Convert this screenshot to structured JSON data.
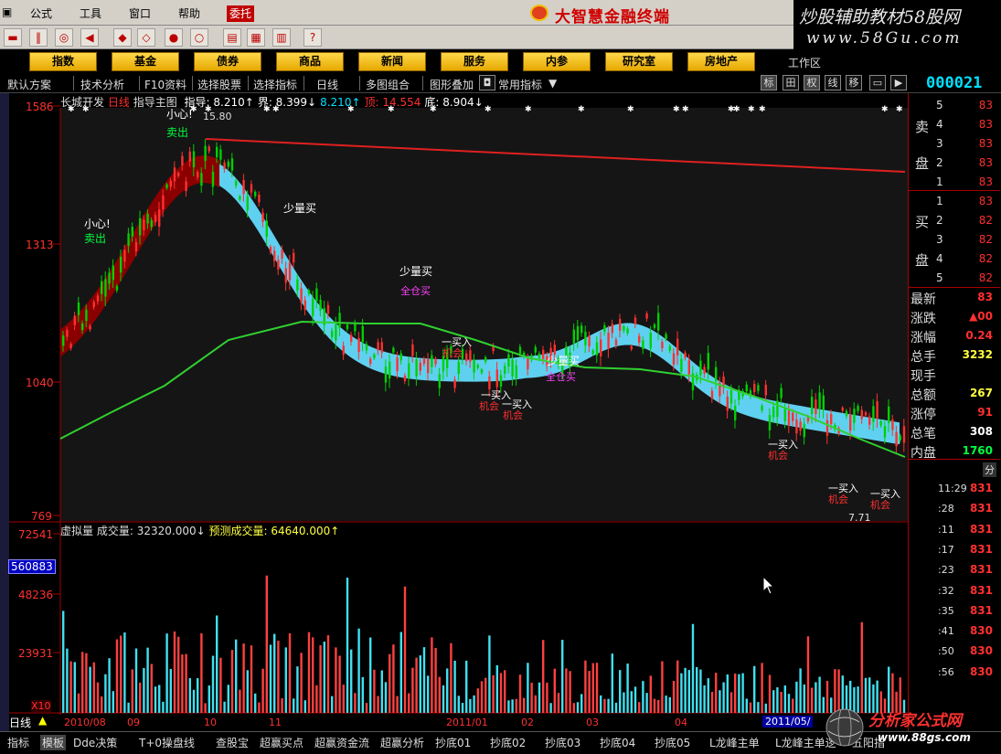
{
  "menu": {
    "items": [
      "公式",
      "工具",
      "窗口",
      "帮助"
    ],
    "red_item": "委托",
    "brand": "大智慧金融终端"
  },
  "watermark_top": {
    "line1": "炒股辅助教材58股网",
    "line2": "www.58Gu.com"
  },
  "nav_buttons": [
    "指数",
    "基金",
    "债券",
    "商品",
    "新闻",
    "服务",
    "内参",
    "研究室",
    "房地产"
  ],
  "workarea_label": "工作区",
  "tabs": [
    "默认方案",
    "技术分析",
    "F10资料",
    "选择股票",
    "选择指标",
    "日线",
    "多图组合",
    "图形叠加",
    "常用指标"
  ],
  "right_tabs": [
    "标",
    "田",
    "权",
    "线",
    "移"
  ],
  "stock_code": "000021",
  "price_chart": {
    "indicator_line": "长城开发",
    "period": "日线",
    "legend_prefix": "指导主图",
    "legend_items": [
      {
        "label": "指导",
        "value": "8.210↑",
        "color": "#ffffff"
      },
      {
        "label": "界",
        "value": "8.399↓",
        "color": "#ffffff"
      },
      {
        "label": "",
        "value": "8.210↑",
        "color": "#00e0ff"
      },
      {
        "label": "顶",
        "value": "14.554",
        "color": "#ff3030"
      },
      {
        "label": "底",
        "value": "8.904↓",
        "color": "#ffffff"
      }
    ],
    "y_ticks": [
      "1586",
      "1313",
      "1040",
      "769"
    ],
    "high_label": "15.80",
    "low_label": "7.71",
    "annotations": [
      {
        "text": "小心!",
        "color": "#ffffff"
      },
      {
        "text": "卖出",
        "color": "#00ff40"
      },
      {
        "text": "小心!",
        "color": "#ffffff"
      },
      {
        "text": "卖出",
        "color": "#00ff40"
      },
      {
        "text": "少量买",
        "color": "#ffffff"
      },
      {
        "text": "少量买",
        "color": "#ffffff"
      },
      {
        "text": "全仓买",
        "color": "#ff40ff"
      },
      {
        "text": "一买入",
        "color": "#ffffff"
      },
      {
        "text": "机会",
        "color": "#ff3030"
      },
      {
        "text": "一买入",
        "color": "#ffffff"
      },
      {
        "text": "机会",
        "color": "#ff3030"
      },
      {
        "text": "一买入",
        "color": "#ffffff"
      },
      {
        "text": "机会",
        "color": "#ff3030"
      },
      {
        "text": "少量买",
        "color": "#ffffff"
      },
      {
        "text": "全仓买",
        "color": "#ff40ff"
      },
      {
        "text": "一买入",
        "color": "#ffffff"
      },
      {
        "text": "机会",
        "color": "#ff3030"
      },
      {
        "text": "一买入",
        "color": "#ffffff"
      },
      {
        "text": "机会",
        "color": "#ff3030"
      },
      {
        "text": "一买入",
        "color": "#ffffff"
      },
      {
        "text": "机会",
        "color": "#ff3030"
      }
    ]
  },
  "volume_chart": {
    "legend_prefix": "虚拟量",
    "vol_label": "成交量:",
    "vol_value": "32320.000↓",
    "pred_label": "预测成交量:",
    "pred_value": "64640.000↑",
    "y_ticks": [
      "72541",
      "48236",
      "23931"
    ],
    "highlight_tick": "560883",
    "unit": "X10"
  },
  "x_axis": {
    "period_label": "日线",
    "labels": [
      "2010/08",
      "09",
      "10",
      "11",
      "2011/01",
      "02",
      "03",
      "04",
      "2011/05/"
    ]
  },
  "right_panel": {
    "sell_label": [
      "卖",
      "盘"
    ],
    "buy_label": [
      "买",
      "盘"
    ],
    "sell_rows": [
      {
        "n": "5",
        "p": "83"
      },
      {
        "n": "4",
        "p": "83"
      },
      {
        "n": "3",
        "p": "83"
      },
      {
        "n": "2",
        "p": "83"
      },
      {
        "n": "1",
        "p": "83"
      }
    ],
    "buy_rows": [
      {
        "n": "1",
        "p": "83"
      },
      {
        "n": "2",
        "p": "82"
      },
      {
        "n": "3",
        "p": "82"
      },
      {
        "n": "4",
        "p": "82"
      },
      {
        "n": "5",
        "p": "82"
      }
    ],
    "stats": [
      {
        "k": "最新",
        "v": "83",
        "color": "#ff3030"
      },
      {
        "k": "涨跌",
        "v": "▲00",
        "color": "#ff3030"
      },
      {
        "k": "涨幅",
        "v": "0.24",
        "color": "#ff3030"
      },
      {
        "k": "总手",
        "v": "3232",
        "color": "#ffff40"
      },
      {
        "k": "现手",
        "v": "",
        "color": "#ffff40"
      },
      {
        "k": "总额",
        "v": "267",
        "color": "#ffff40"
      },
      {
        "k": "涨停",
        "v": "91",
        "color": "#ff3030"
      },
      {
        "k": "总笔",
        "v": "308",
        "color": "#ffffff"
      },
      {
        "k": "内盘",
        "v": "1760",
        "color": "#00ff40"
      }
    ],
    "tick_header": "分",
    "ticks": [
      {
        "t": "11:29",
        "p": "831"
      },
      {
        "t": ":28",
        "p": "831"
      },
      {
        "t": ":11",
        "p": "831"
      },
      {
        "t": ":17",
        "p": "831"
      },
      {
        "t": ":23",
        "p": "831"
      },
      {
        "t": ":32",
        "p": "831"
      },
      {
        "t": ":35",
        "p": "831"
      },
      {
        "t": ":41",
        "p": "830"
      },
      {
        "t": ":50",
        "p": "830"
      },
      {
        "t": ":56",
        "p": "830"
      }
    ]
  },
  "bottom_tabs": [
    "指标",
    "模板",
    "Dde决策",
    "T+0操盘线",
    "查股宝",
    "超赢买点",
    "超赢资金流",
    "超赢分析",
    "抄底01",
    "抄底02",
    "抄底03",
    "抄底04",
    "抄底05",
    "L龙峰主单",
    "L龙峰主单逻",
    "五阳指"
  ],
  "watermark_bottom": {
    "line1": "分析家公式网",
    "line2": "www.88gs.com"
  }
}
